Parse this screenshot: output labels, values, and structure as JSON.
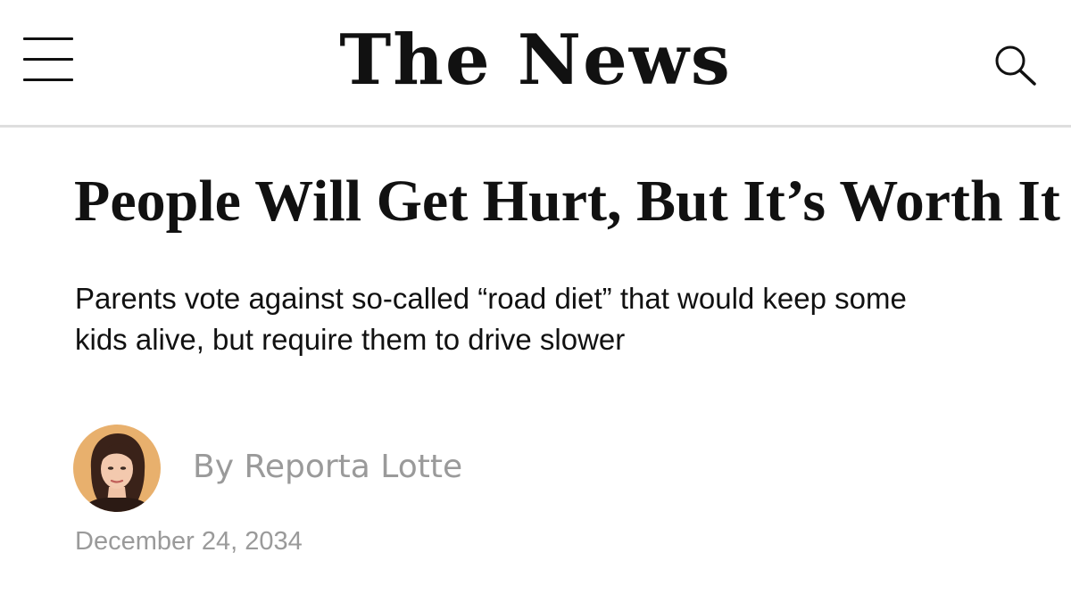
{
  "header": {
    "logo": "The News",
    "menu_icon": "hamburger-menu-icon",
    "search_icon": "search-icon"
  },
  "article": {
    "headline": "People Will Get Hurt, But It’s Worth It",
    "subheadline": "Parents vote against so-called “road diet” that would keep some kids alive, but require them to drive slower",
    "author": "By Reporta Lotte",
    "date": "December 24, 2034"
  },
  "colors": {
    "text": "#111111",
    "muted": "#9a9a9a",
    "divider": "#dedede",
    "avatar_bg": "#e8b06d"
  }
}
